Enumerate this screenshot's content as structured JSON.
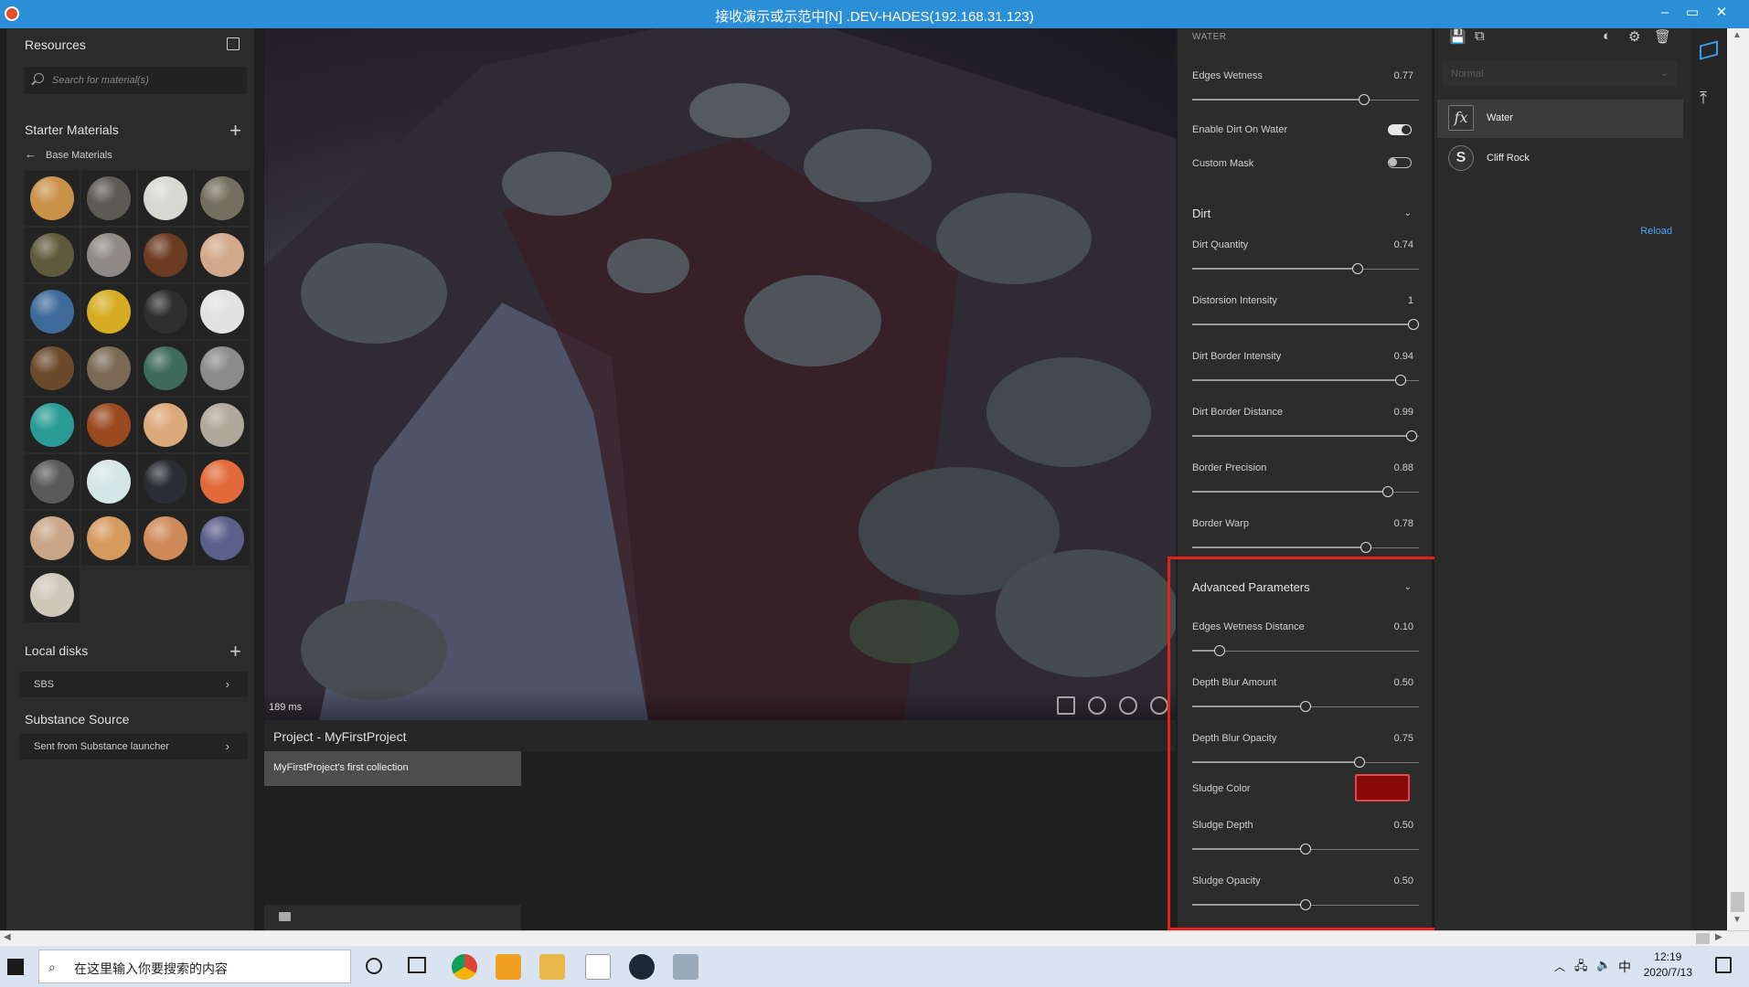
{
  "window": {
    "title": "接收演示或示范中[N] .DEV-HADES(192.168.31.123)"
  },
  "left": {
    "resources_title": "Resources",
    "search_placeholder": "Search for material(s)",
    "starter_title": "Starter Materials",
    "base_materials": "Base Materials",
    "materials": [
      {
        "name": "sphere-1",
        "color": "#c9914a"
      },
      {
        "name": "sphere-2",
        "color": "#5d5a54"
      },
      {
        "name": "sphere-3",
        "color": "#d8d8d2"
      },
      {
        "name": "sphere-4",
        "color": "#74705f"
      },
      {
        "name": "sphere-5",
        "color": "#5f5a3c"
      },
      {
        "name": "sphere-6",
        "color": "#8e8984"
      },
      {
        "name": "sphere-7",
        "color": "#6b3b22"
      },
      {
        "name": "sphere-8",
        "color": "#d2a98a"
      },
      {
        "name": "sphere-9",
        "color": "#3e6a9a"
      },
      {
        "name": "sphere-10",
        "color": "#d6ad22"
      },
      {
        "name": "sphere-11",
        "color": "#2e2e2e"
      },
      {
        "name": "sphere-12",
        "color": "#e2e2e2"
      },
      {
        "name": "sphere-13",
        "color": "#6b4a2c"
      },
      {
        "name": "sphere-14",
        "color": "#7a6a55"
      },
      {
        "name": "sphere-15",
        "color": "#3d6a5a"
      },
      {
        "name": "sphere-16",
        "color": "#8a8b8a"
      },
      {
        "name": "sphere-17",
        "color": "#2a9b95"
      },
      {
        "name": "sphere-18",
        "color": "#9a4a1e"
      },
      {
        "name": "sphere-19",
        "color": "#dca97a"
      },
      {
        "name": "sphere-20",
        "color": "#b1a79a"
      },
      {
        "name": "sphere-21",
        "color": "#5a5a5a"
      },
      {
        "name": "sphere-22",
        "color": "#d6e6e6"
      },
      {
        "name": "sphere-23",
        "color": "#2a2d33"
      },
      {
        "name": "sphere-24",
        "color": "#e2693a"
      },
      {
        "name": "sphere-25",
        "color": "#c9a687"
      },
      {
        "name": "sphere-26",
        "color": "#d69a5e"
      },
      {
        "name": "sphere-27",
        "color": "#cf8a5a"
      },
      {
        "name": "sphere-28",
        "color": "#5b5f8c"
      },
      {
        "name": "sphere-29",
        "color": "#cfc8ba"
      }
    ],
    "local_disks_title": "Local disks",
    "sbs": "SBS",
    "source_title": "Substance Source",
    "source_item": "Sent from Substance launcher"
  },
  "viewport": {
    "render_time": "189 ms"
  },
  "project": {
    "title": "Project - MyFirstProject",
    "collection": "MyFirstProject's first collection"
  },
  "props": {
    "section": "WATER",
    "edges_wetness": {
      "label": "Edges Wetness",
      "value": "0.77",
      "fraction": 0.77
    },
    "enable_dirt": {
      "label": "Enable Dirt On Water",
      "on": true
    },
    "custom_mask": {
      "label": "Custom Mask",
      "on": false
    },
    "dirt_title": "Dirt",
    "dirt": [
      {
        "label": "Dirt Quantity",
        "value": "0.74",
        "fraction": 0.74
      },
      {
        "label": "Distorsion Intensity",
        "value": "1",
        "fraction": 1.0
      },
      {
        "label": "Dirt Border Intensity",
        "value": "0.94",
        "fraction": 0.94
      },
      {
        "label": "Dirt Border Distance",
        "value": "0.99",
        "fraction": 0.99
      },
      {
        "label": "Border Precision",
        "value": "0.88",
        "fraction": 0.88
      },
      {
        "label": "Border Warp",
        "value": "0.78",
        "fraction": 0.78
      }
    ],
    "advanced_title": "Advanced Parameters",
    "advanced": [
      {
        "label": "Edges Wetness Distance",
        "value": "0.10",
        "fraction": 0.1
      },
      {
        "label": "Depth Blur Amount",
        "value": "0.50",
        "fraction": 0.5
      },
      {
        "label": "Depth Blur Opacity",
        "value": "0.75",
        "fraction": 0.75
      }
    ],
    "sludge_color": {
      "label": "Sludge Color",
      "color": "#8a0a0a"
    },
    "sludge": [
      {
        "label": "Sludge Depth",
        "value": "0.50",
        "fraction": 0.5
      },
      {
        "label": "Sludge Opacity",
        "value": "0.50",
        "fraction": 0.5
      }
    ]
  },
  "layers": {
    "blend_mode": "Normal",
    "items": [
      {
        "name": "Water",
        "icon": "fx"
      },
      {
        "name": "Cliff Rock",
        "icon": "S"
      }
    ],
    "reload": "Reload"
  },
  "taskbar": {
    "search_placeholder": "在这里输入你要搜索的内容",
    "time": "12:19",
    "date": "2020/7/13",
    "ime": "中"
  }
}
